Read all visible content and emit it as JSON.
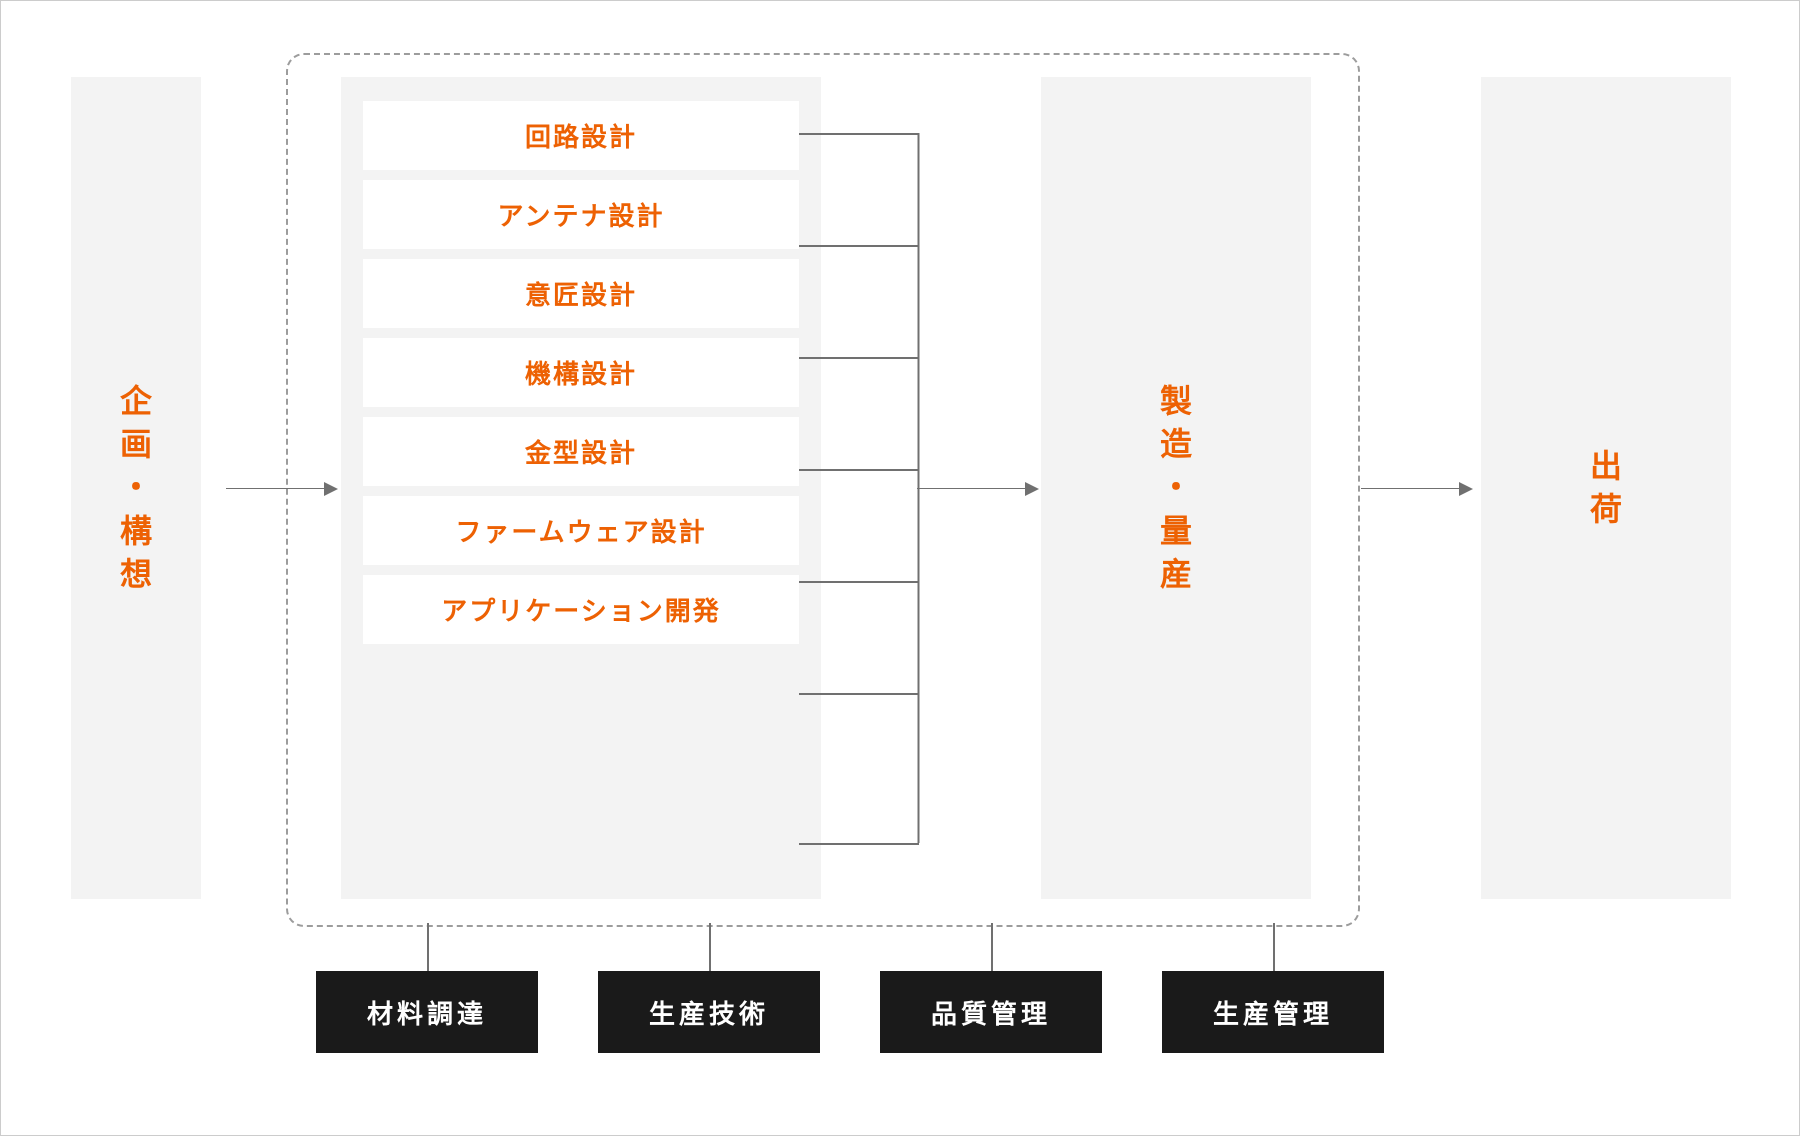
{
  "stages": {
    "plan": "企画・構想",
    "design_items": [
      "回路設計",
      "アンテナ設計",
      "意匠設計",
      "機構設計",
      "金型設計",
      "ファームウェア設計",
      "アプリケーション開発"
    ],
    "manufacture": "製造・量産",
    "ship": "出荷"
  },
  "support": [
    "材料調達",
    "生産技術",
    "品質管理",
    "生産管理"
  ],
  "colors": {
    "accent": "#ed6103",
    "block_bg": "#f3f3f3",
    "dark": "#1a1a1a",
    "connector": "#707070"
  }
}
